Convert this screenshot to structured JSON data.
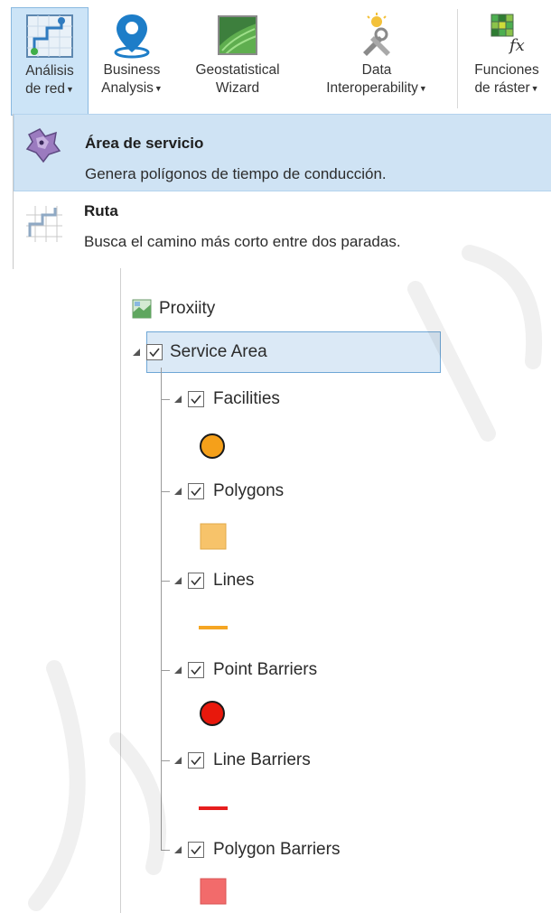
{
  "ribbon": {
    "buttons": [
      {
        "line1": "Análisis",
        "line2": "de red",
        "dropdown": true,
        "icon": "network-analysis-icon"
      },
      {
        "line1": "Business",
        "line2": "Analysis",
        "dropdown": true,
        "icon": "business-analysis-icon"
      },
      {
        "line1": "Geostatistical",
        "line2": "Wizard",
        "dropdown": false,
        "icon": "geostatistical-wizard-icon"
      },
      {
        "line1": "Data",
        "line2": "Interoperability",
        "dropdown": true,
        "icon": "data-interoperability-icon"
      },
      {
        "line1": "Funciones",
        "line2": "de ráster",
        "dropdown": true,
        "icon": "raster-functions-icon"
      }
    ]
  },
  "dropdown": {
    "items": [
      {
        "title": "Área de servicio",
        "description": "Genera polígonos de tiempo de conducción.",
        "icon": "service-area-icon"
      },
      {
        "title": "Ruta",
        "description": "Busca el camino más corto entre dos paradas.",
        "icon": "route-icon"
      }
    ]
  },
  "toc": {
    "map_name": "Proxiity",
    "group_layer": "Service Area",
    "sublayers": [
      {
        "name": "Facilities",
        "symbol": "circle",
        "color": "#f5a01a"
      },
      {
        "name": "Polygons",
        "symbol": "square",
        "color": "#f7c36a"
      },
      {
        "name": "Lines",
        "symbol": "line",
        "color": "#f5a623"
      },
      {
        "name": "Point Barriers",
        "symbol": "circle",
        "color": "#e8180c"
      },
      {
        "name": "Line Barriers",
        "symbol": "line",
        "color": "#e61e1e"
      },
      {
        "name": "Polygon Barriers",
        "symbol": "square",
        "color": "#f26b6b"
      }
    ]
  },
  "colors": {
    "ribbon_active": "#cce4f7",
    "dropdown_highlight": "#cfe3f4",
    "toc_selection": "#dbe9f6"
  }
}
